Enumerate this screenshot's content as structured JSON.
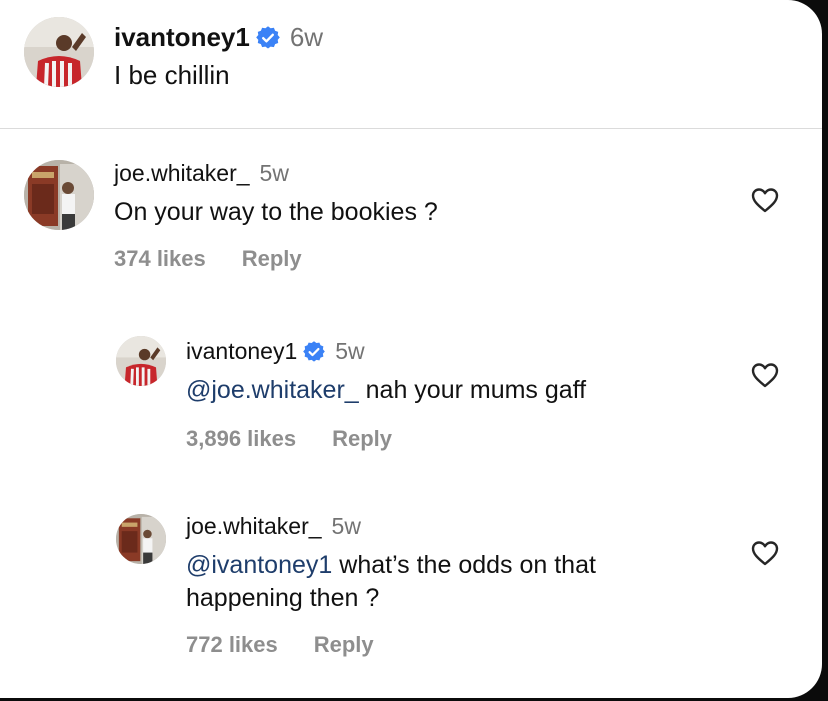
{
  "caption": {
    "username": "ivantoney1",
    "verified": true,
    "time": "6w",
    "text": "I be chillin"
  },
  "comments": [
    {
      "username": "joe.whitaker_",
      "time": "5w",
      "text": "On your way to the bookies ?",
      "likes": "374 likes",
      "reply_label": "Reply"
    },
    {
      "username": "ivantoney1",
      "verified": true,
      "time": "5w",
      "mention": "@joe.whitaker_",
      "text": " nah your mums gaff",
      "likes": "3,896 likes",
      "reply_label": "Reply"
    },
    {
      "username": "joe.whitaker_",
      "time": "5w",
      "mention": "@ivantoney1",
      "text": " what’s the odds on that",
      "text_line2": "happening then ?",
      "likes": "772 likes",
      "reply_label": "Reply"
    }
  ],
  "colors": {
    "verified_badge": "#3b82f6",
    "mention": "#1e3d6b",
    "meta": "#8e8e8e",
    "time": "#737373"
  },
  "icons": [
    "avatar-image",
    "verified-badge-icon",
    "heart-icon"
  ]
}
